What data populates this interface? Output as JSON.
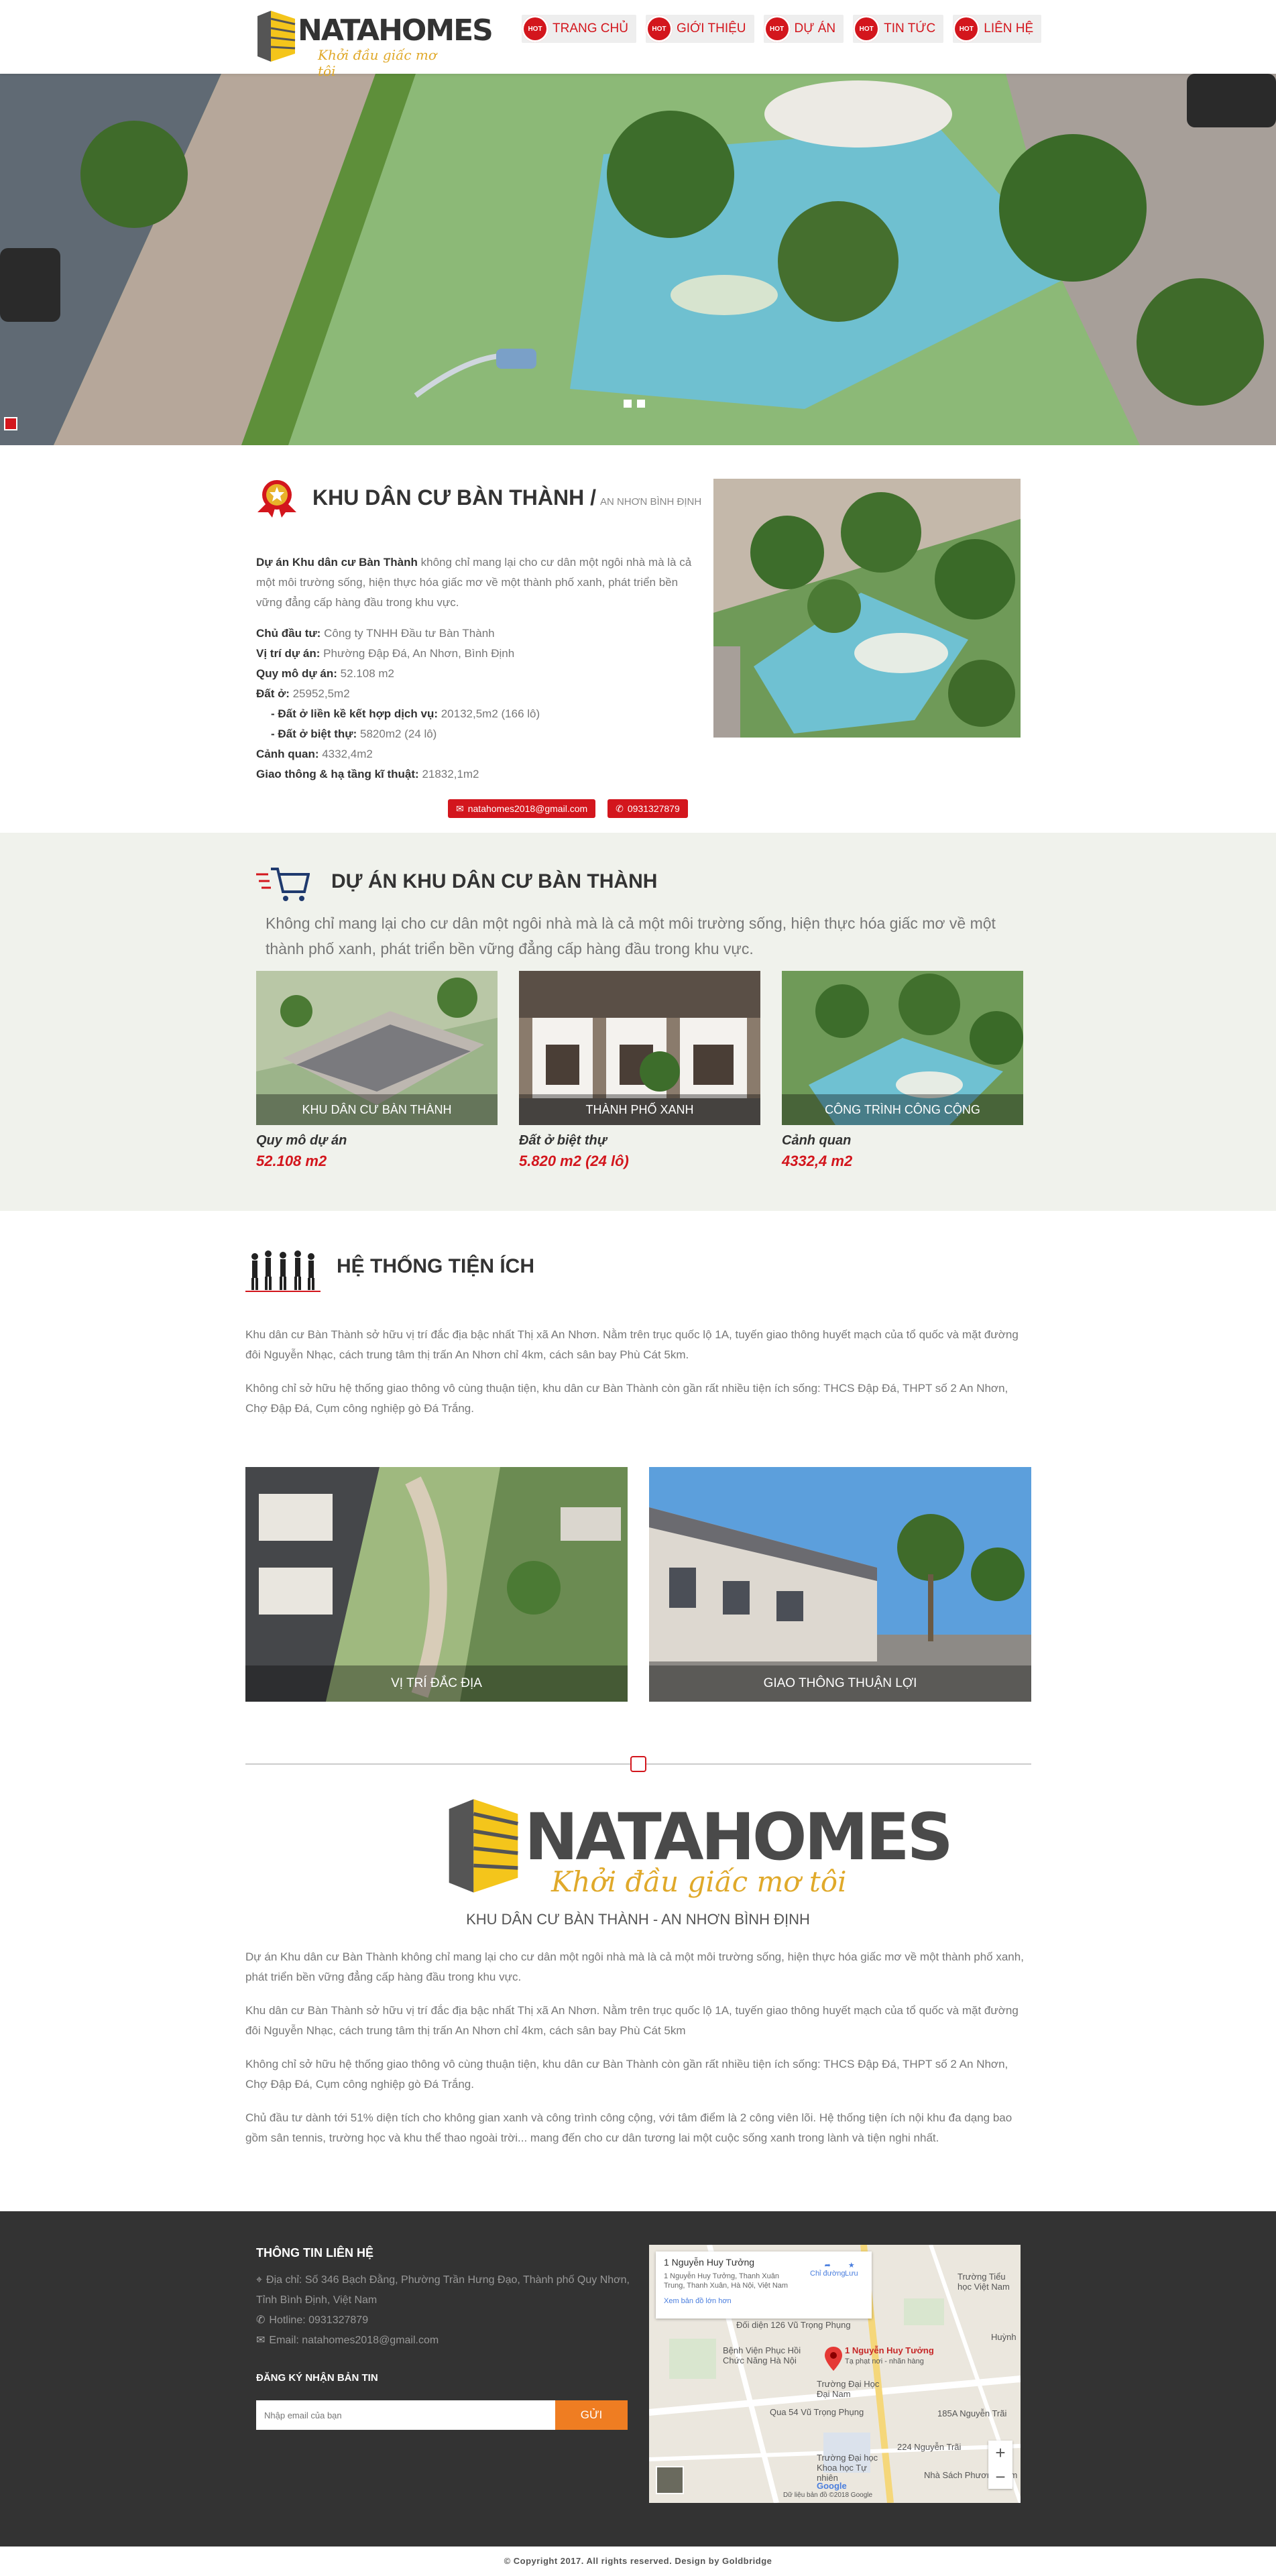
{
  "header": {
    "logo_text": "NATAHOMES",
    "logo_slogan": "Khởi đầu giấc mơ tôi",
    "hot_badge": "HOT",
    "nav": [
      {
        "label": "TRANG CHỦ"
      },
      {
        "label": "GIỚI THIỆU"
      },
      {
        "label": "DỰ ÁN"
      },
      {
        "label": "TIN TỨC"
      },
      {
        "label": "LIÊN HỆ"
      }
    ]
  },
  "intro": {
    "title": "KHU DÂN CƯ BÀN THÀNH /",
    "subtitle": "AN NHƠN BÌNH ĐỊNH",
    "desc_bold": "Dự án Khu dân cư Bàn Thành",
    "desc_rest": " không chỉ mang lại cho cư dân một ngôi nhà mà là cả một môi trường sống, hiện thực hóa giấc mơ về một thành phố xanh, phát triển bền vững đẳng cấp hàng đầu trong khu vực.",
    "specs": [
      {
        "label": "Chủ đầu tư:",
        "value": " Công ty TNHH Đầu tư Bàn Thành"
      },
      {
        "label": "Vị trí dự án:",
        "value": " Phường Đập Đá, An Nhơn, Bình Định"
      },
      {
        "label": "Quy mô dự án:",
        "value": " 52.108 m2"
      },
      {
        "label": "Đất ở:",
        "value": " 25952,5m2"
      },
      {
        "label": "- Đất ở liền kề kết hợp dịch vụ:",
        "value": " 20132,5m2 (166 lô)"
      },
      {
        "label": "- Đất ở biệt thự:",
        "value": " 5820m2 (24 lô)"
      },
      {
        "label": "Cảnh quan:",
        "value": " 4332,4m2"
      },
      {
        "label": "Giao thông & hạ tầng kĩ thuật:",
        "value": " 21832,1m2"
      }
    ],
    "email": "natahomes2018@gmail.com",
    "phone": "0931327879"
  },
  "project": {
    "title": "DỰ ÁN KHU DÂN CƯ BÀN THÀNH",
    "desc": "Không chỉ mang lại cho cư dân một ngôi nhà mà là cả một môi trường sống, hiện thực hóa giấc mơ về một thành phố xanh, phát triển bền vững đẳng cấp hàng đầu trong khu vực.",
    "cards": [
      {
        "caption": "KHU DÂN CƯ BÀN THÀNH",
        "label": "Quy mô dự án",
        "value": "52.108 m2"
      },
      {
        "caption": "THÀNH PHỐ XANH",
        "label": "Đất ở biệt thự",
        "value": "5.820 m2 (24 lô)"
      },
      {
        "caption": "CÔNG TRÌNH CÔNG CỘNG",
        "label": "Cảnh quan",
        "value": "4332,4 m2"
      }
    ]
  },
  "amenities": {
    "title": "HỆ THỐNG TIỆN ÍCH",
    "p1": "Khu dân cư Bàn Thành sở hữu vị trí đắc địa bậc nhất Thị xã An Nhơn. Nằm trên trục quốc lộ 1A, tuyến giao thông huyết mạch của tổ quốc và mặt đường đôi Nguyễn Nhạc, cách trung tâm thị trấn An Nhơn chỉ 4km, cách sân bay Phù Cát 5km.",
    "p2": "Không chỉ sở hữu hệ thống giao thông vô cùng thuận tiện, khu dân cư Bàn Thành còn gần rất nhiều tiện ích sống: THCS Đập Đá, THPT số 2 An Nhơn, Chợ Đập Đá, Cụm công nghiệp gò Đá Trắng.",
    "photos": [
      {
        "caption": "VỊ TRÍ ĐẮC ĐỊA"
      },
      {
        "caption": "GIAO THÔNG THUẬN LỢI"
      }
    ]
  },
  "about": {
    "logo_text": "NATAHOMES",
    "logo_slogan": "Khởi đầu giấc mơ tôi",
    "subtitle": "KHU DÂN CƯ BÀN THÀNH - AN NHƠN BÌNH ĐỊNH",
    "paragraphs": [
      "Dự án Khu dân cư Bàn Thành không chỉ mang lại cho cư dân một ngôi nhà mà là cả một môi trường sống, hiện thực hóa giấc mơ về một thành phố xanh, phát triển bền vững đẳng cấp hàng đầu trong khu vực.",
      "Khu dân cư Bàn Thành sở hữu vị trí đắc địa bậc nhất Thị xã An Nhơn. Nằm trên trục quốc lộ 1A, tuyến giao thông huyết mạch của tổ quốc và mặt đường đôi Nguyễn Nhạc, cách trung tâm thị trấn An Nhơn chỉ 4km, cách sân bay Phù Cát 5km",
      "Không chỉ sở hữu hệ thống giao thông vô cùng thuận tiện, khu dân cư Bàn Thành còn gần rất nhiều tiện ích sống: THCS Đập Đá, THPT số 2 An Nhơn, Chợ Đập Đá, Cụm công nghiệp gò Đá Trắng.",
      "Chủ đầu tư dành tới 51% diện tích cho không gian xanh và công trình công cộng, với tâm điểm là 2 công viên lõi. Hệ thống tiện ích nội khu đa dạng bao gồm sân tennis, trường học và khu thể thao ngoài trời... mang đến cho cư dân tương lai một cuộc sống xanh trong lành và tiện nghi nhất."
    ]
  },
  "footer": {
    "contact_title": "THÔNG TIN LIÊN HỆ",
    "address": "Địa chỉ: Số 346 Bạch Đằng, Phường Trần Hưng Đạo, Thành phố Quy Nhơn, Tỉnh Bình Định, Việt Nam",
    "hotline": "Hotline: 0931327879",
    "email": "Email: natahomes2018@gmail.com",
    "newsletter_title": "ĐĂNG KÝ NHẬN BẢN TIN",
    "newsletter_placeholder": "Nhập email của bạn",
    "newsletter_button": "GỬI",
    "map": {
      "place": "1 Nguyễn Huy Tưởng",
      "address": "1 Nguyễn Huy Tưởng, Thanh Xuân Trung, Thanh Xuân, Hà Nội, Việt Nam",
      "directions": "Chỉ đường",
      "save": "Lưu",
      "larger_map": "Xem bản đồ lớn hơn",
      "pin_label": "1 Nguyễn Huy Tưởng",
      "pin_sub": "Tạ phạt nơi - nhãn hàng",
      "labels": [
        "Đối diện 126 Vũ Trọng Phụng",
        "Bệnh Viện Phục Hồi Chức Năng Hà Nội",
        "Trường Đại Học Đại Nam",
        "Qua 54 Vũ Trọng Phụng",
        "185A Nguyễn Trãi",
        "224 Nguyễn Trãi",
        "Trường Đại học Khoa học Tự nhiên",
        "Nhà Sách Phương Nam",
        "Trường Tiểu học Việt Nam",
        "Huỳnh",
        "Google",
        "Dữ liệu bản đồ ©2018 Google"
      ]
    },
    "copyright": "© Copyright 2017. All rights reserved. Design by Goldbridge"
  }
}
